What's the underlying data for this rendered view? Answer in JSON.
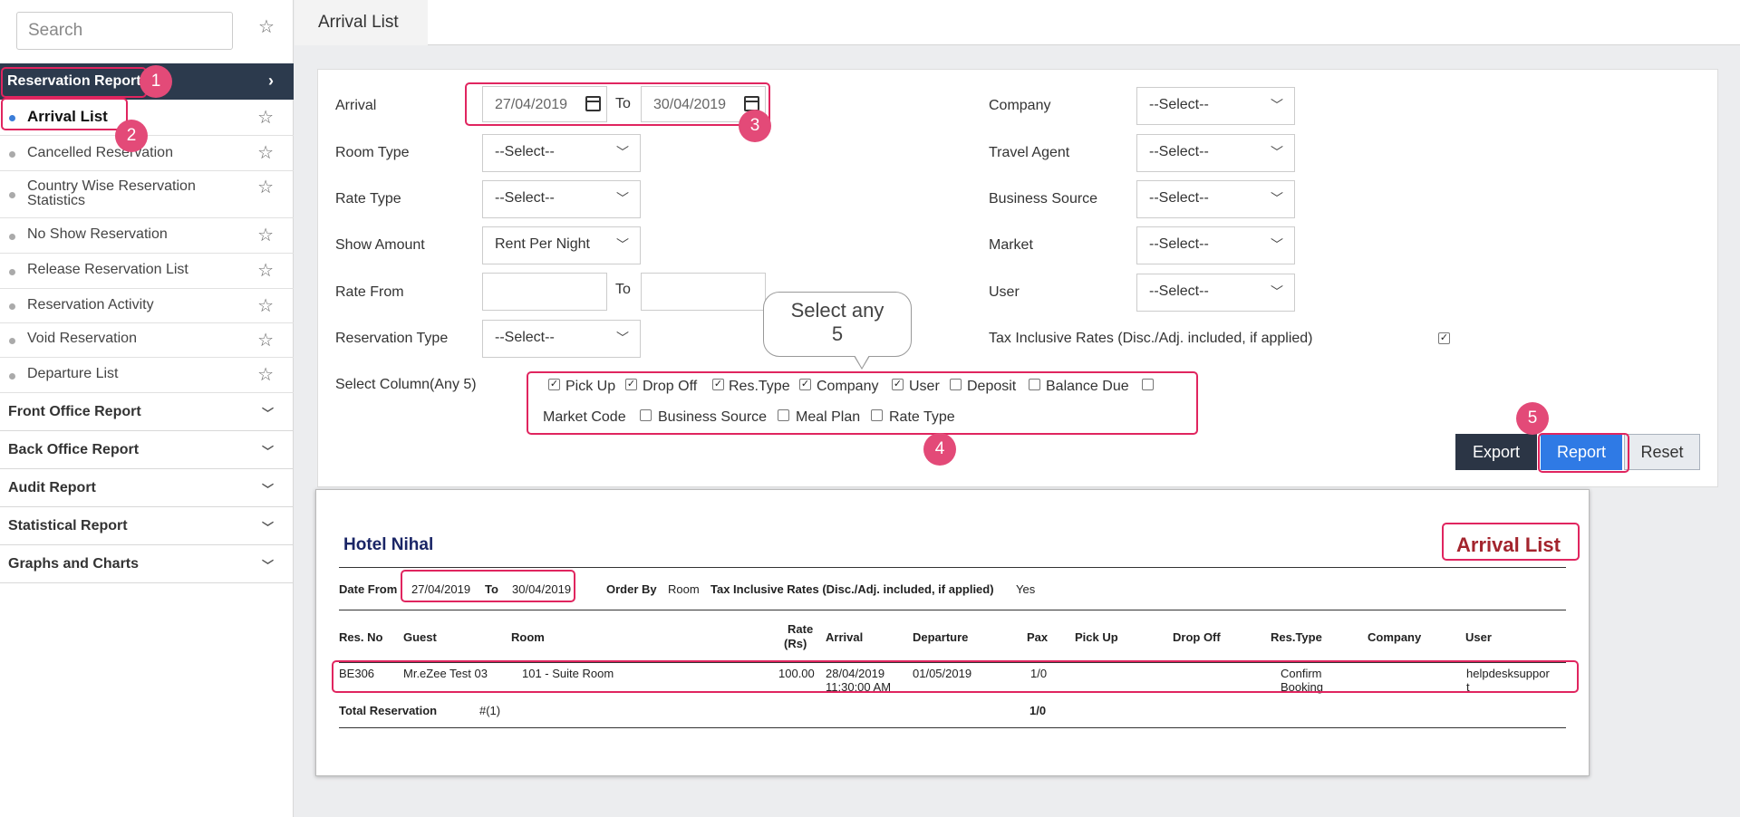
{
  "sidebar": {
    "search_placeholder": "Search",
    "active_section": "Reservation Report",
    "items": [
      {
        "label": "Arrival List"
      },
      {
        "label": "Cancelled Reservation"
      },
      {
        "label": "Country Wise Reservation Statistics"
      },
      {
        "label": "No Show Reservation"
      },
      {
        "label": "Release Reservation List"
      },
      {
        "label": "Reservation Activity"
      },
      {
        "label": "Void Reservation"
      },
      {
        "label": "Departure List"
      }
    ],
    "sections": [
      {
        "label": "Front Office Report"
      },
      {
        "label": "Back Office Report"
      },
      {
        "label": "Audit Report"
      },
      {
        "label": "Statistical Report"
      },
      {
        "label": "Graphs and Charts"
      }
    ]
  },
  "tab": {
    "title": "Arrival List"
  },
  "filters": {
    "arrival_label": "Arrival",
    "arrival_from": "27/04/2019",
    "to_label": "To",
    "arrival_to": "30/04/2019",
    "room_type_label": "Room Type",
    "room_type_value": "--Select--",
    "rate_type_label": "Rate Type",
    "rate_type_value": "--Select--",
    "show_amount_label": "Show Amount",
    "show_amount_value": "Rent Per Night",
    "rate_from_label": "Rate From",
    "reservation_type_label": "Reservation Type",
    "reservation_type_value": "--Select--",
    "select_column_label": "Select Column(Any 5)",
    "company_label": "Company",
    "company_value": "--Select--",
    "travel_agent_label": "Travel Agent",
    "travel_agent_value": "--Select--",
    "business_source_label": "Business Source",
    "business_source_value": "--Select--",
    "market_label": "Market",
    "market_value": "--Select--",
    "user_label": "User",
    "user_value": "--Select--",
    "tax_label": "Tax Inclusive Rates (Disc./Adj. included, if applied)",
    "columns": [
      {
        "label": "Pick Up",
        "checked": true
      },
      {
        "label": "Drop Off",
        "checked": true
      },
      {
        "label": "Res.Type",
        "checked": true
      },
      {
        "label": "Company",
        "checked": true
      },
      {
        "label": "User",
        "checked": true
      },
      {
        "label": "Deposit",
        "checked": false
      },
      {
        "label": "Balance Due",
        "checked": false
      },
      {
        "label": "Market Code",
        "checked": false
      },
      {
        "label": "Business Source",
        "checked": false
      },
      {
        "label": "Meal Plan",
        "checked": false
      },
      {
        "label": "Rate Type",
        "checked": false
      }
    ]
  },
  "buttons": {
    "export": "Export",
    "report": "Report",
    "reset": "Reset"
  },
  "annotations": {
    "bubble_line1": "Select any",
    "bubble_line2": "5",
    "badges": [
      "1",
      "2",
      "3",
      "4",
      "5"
    ],
    "color": "#e0255f"
  },
  "report": {
    "hotel_name": "Hotel Nihal",
    "title": "Arrival List",
    "date_from_label": "Date From",
    "date_from": "27/04/2019",
    "to_label": "To",
    "date_to": "30/04/2019",
    "order_by_label": "Order By",
    "order_by": "Room",
    "tax_label": "Tax Inclusive Rates (Disc./Adj. included, if applied)",
    "tax_value": "Yes",
    "headers": {
      "res_no": "Res. No",
      "guest": "Guest",
      "room": "Room",
      "rate_l1": "Rate",
      "rate_l2": "(Rs)",
      "arrival": "Arrival",
      "departure": "Departure",
      "pax": "Pax",
      "pick_up": "Pick Up",
      "drop_off": "Drop Off",
      "res_type": "Res.Type",
      "company": "Company",
      "user": "User"
    },
    "row": {
      "res_no": "BE306",
      "guest": "Mr.eZee Test 03",
      "room": "101 - Suite Room",
      "rate": "100.00",
      "arrival_l1": "28/04/2019",
      "arrival_l2": "11:30:00 AM",
      "departure": "01/05/2019",
      "pax": "1/0",
      "res_type_l1": "Confirm",
      "res_type_l2": "Booking",
      "user_l1": "helpdesksuppor",
      "user_l2": "t"
    },
    "total_label": "Total Reservation",
    "total_count": "#(1)",
    "total_pax": "1/0",
    "title_color": "#a3242d",
    "hotel_color": "#1a2566"
  }
}
